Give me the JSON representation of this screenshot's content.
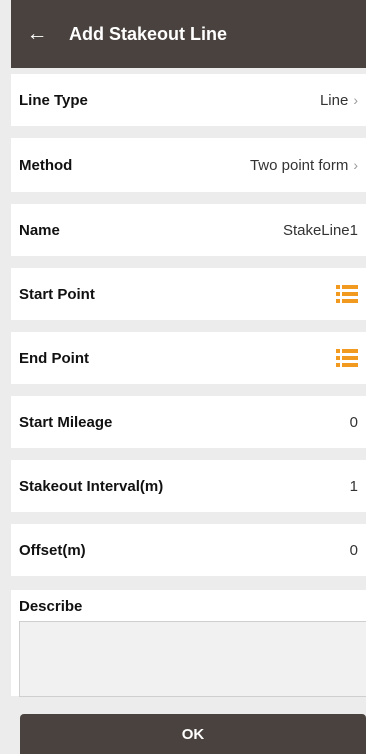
{
  "header": {
    "back_icon": "arrow-left-icon",
    "title": "Add Stakeout Line"
  },
  "rows": {
    "line_type": {
      "label": "Line Type",
      "value": "Line",
      "chevron": "›"
    },
    "method": {
      "label": "Method",
      "value": "Two point form",
      "chevron": "›"
    },
    "name": {
      "label": "Name",
      "value": "StakeLine1"
    },
    "start_point": {
      "label": "Start Point",
      "icon": "list-icon"
    },
    "end_point": {
      "label": "End Point",
      "icon": "list-icon"
    },
    "start_mileage": {
      "label": "Start Mileage",
      "value": "0"
    },
    "stakeout_interval": {
      "label": "Stakeout Interval(m)",
      "value": "1"
    },
    "offset": {
      "label": "Offset(m)",
      "value": "0"
    }
  },
  "describe": {
    "label": "Describe",
    "value": ""
  },
  "ok_label": "OK",
  "colors": {
    "header_bg": "#4a423e",
    "accent_orange": "#f29a1f",
    "page_bg": "#ececec"
  }
}
